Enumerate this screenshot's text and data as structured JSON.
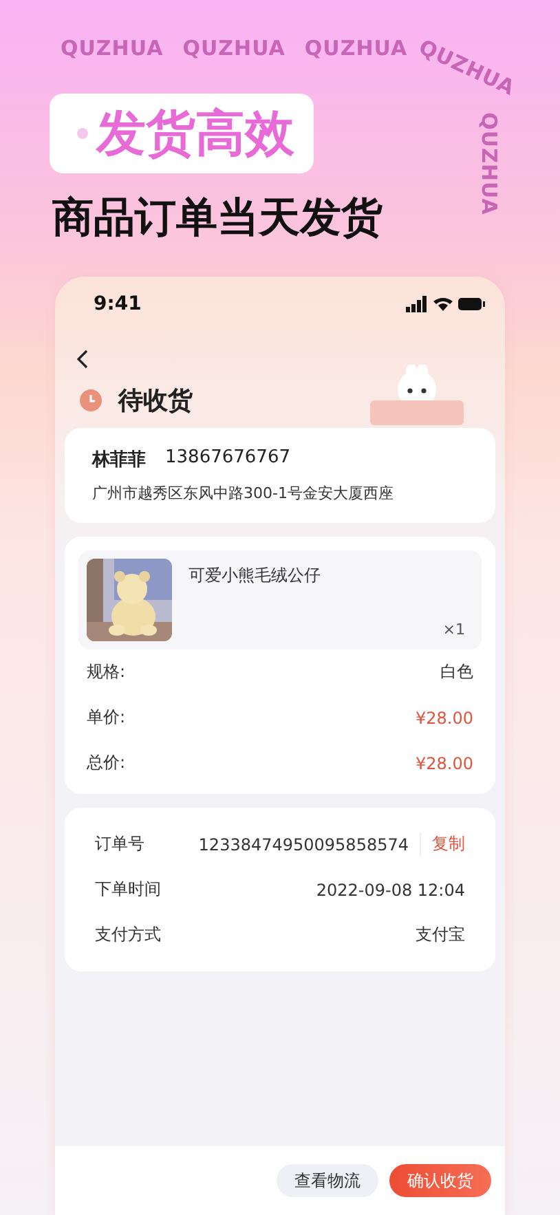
{
  "pattern_words": [
    "QUZHUA",
    "QUZHUA",
    "QUZHUA",
    "QUZHUA",
    "QUZHUA"
  ],
  "headline": "发货高效",
  "subtitle": "商品订单当天发货",
  "status_bar": {
    "time": "9:41"
  },
  "order_status": "待收货",
  "address": {
    "name": "林菲菲",
    "phone": "13867676767",
    "line": "广州市越秀区东风中路300-1号金安大厦西座"
  },
  "product": {
    "title": "可爱小熊毛绒公仔",
    "quantity": "×1"
  },
  "price_rows": [
    {
      "label": "规格:",
      "value": "白色",
      "kind": "plain"
    },
    {
      "label": "单价:",
      "value": "¥28.00",
      "kind": "price"
    },
    {
      "label": "总价:",
      "value": "¥28.00",
      "kind": "price"
    }
  ],
  "order_rows": [
    {
      "label": "订单号",
      "value": "12338474950095858574",
      "action": "复制"
    },
    {
      "label": "下单时间",
      "value": "2022-09-08 12:04"
    },
    {
      "label": "支付方式",
      "value": "支付宝"
    }
  ],
  "buttons": [
    {
      "label": "查看物流",
      "kind": "secondary"
    },
    {
      "label": "确认收货",
      "kind": "primary"
    }
  ]
}
